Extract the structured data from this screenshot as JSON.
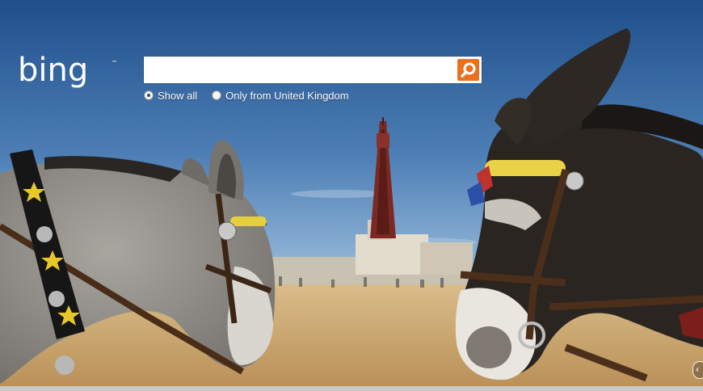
{
  "brand": {
    "name": "bing",
    "trademark": "™"
  },
  "search": {
    "value": "",
    "placeholder": "",
    "go_icon": "magnifier-icon"
  },
  "scope_options": [
    {
      "label": "Show all",
      "selected": true
    },
    {
      "label": "Only from United Kingdom",
      "selected": false
    }
  ],
  "background": {
    "icon": "homepage-photo",
    "colors": {
      "sky_top": "#1f4f8a",
      "sky_bottom": "#8fb4d8",
      "sand": "#c9a56c",
      "accent": "#e8711f"
    }
  },
  "nav": {
    "previous_icon": "chevron-left-icon",
    "previous_glyph": "‹"
  }
}
